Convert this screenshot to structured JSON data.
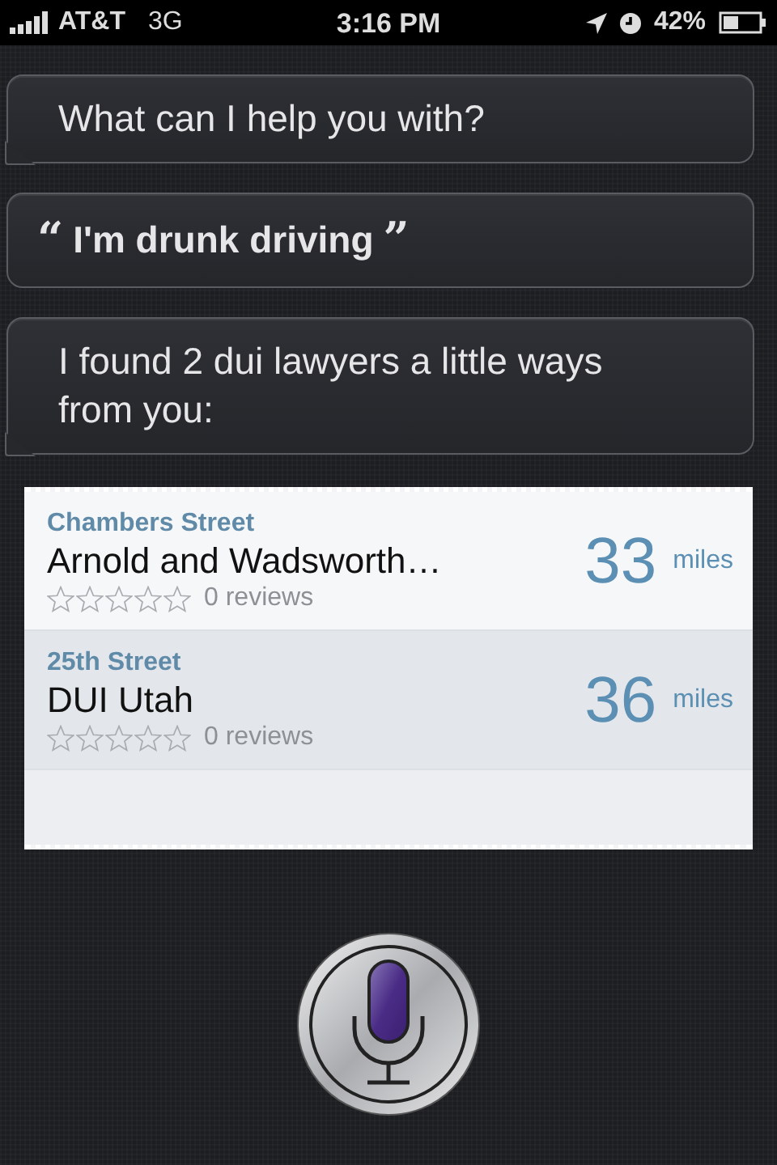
{
  "status_bar": {
    "carrier": "AT&T",
    "network": "3G",
    "time": "3:16 PM",
    "battery": "42%"
  },
  "conversation": [
    {
      "kind": "assistant",
      "text": "What can I help you with?"
    },
    {
      "kind": "user",
      "open_quote": "“",
      "text": "I'm drunk driving",
      "close_quote": "”"
    },
    {
      "kind": "assistant",
      "text": "I found 2 dui lawyers a little ways from you:"
    }
  ],
  "results": [
    {
      "street": "Chambers Street",
      "name": "Arnold and Wadsworth…",
      "stars": 0,
      "reviews": "0 reviews",
      "distance": "33",
      "unit": "miles",
      "selected": false
    },
    {
      "street": "25th Street",
      "name": "DUI Utah",
      "stars": 0,
      "reviews": "0 reviews",
      "distance": "36",
      "unit": "miles",
      "selected": true
    }
  ]
}
